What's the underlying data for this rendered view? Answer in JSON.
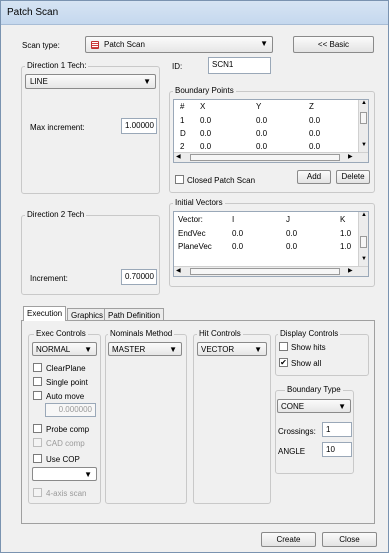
{
  "window": {
    "title": "Patch Scan"
  },
  "scan_type": {
    "label": "Scan type:",
    "value": "Patch Scan",
    "basic_button": "<< Basic"
  },
  "id": {
    "label": "ID:",
    "value": "SCN1"
  },
  "dir1": {
    "label": "Direction 1 Tech:",
    "value": "LINE",
    "max_inc_label": "Max increment:",
    "max_inc_value": "1.00000"
  },
  "dir2": {
    "label": "Direction 2 Tech",
    "inc_label": "Increment:",
    "inc_value": "0.70000"
  },
  "boundary_points": {
    "label": "Boundary Points",
    "columns": [
      "#",
      "X",
      "Y",
      "Z"
    ],
    "rows": [
      [
        "1",
        "0.0",
        "0.0",
        "0.0"
      ],
      [
        "D",
        "0.0",
        "0.0",
        "0.0"
      ],
      [
        "2",
        "0.0",
        "0.0",
        "0.0"
      ]
    ],
    "closed_label": "Closed Patch Scan",
    "add": "Add",
    "delete": "Delete"
  },
  "initial_vectors": {
    "label": "Initial Vectors",
    "columns": [
      "Vector:",
      "I",
      "J",
      "K"
    ],
    "rows": [
      [
        "EndVec",
        "0.0",
        "0.0",
        "1.0"
      ],
      [
        "PlaneVec",
        "0.0",
        "0.0",
        "1.0"
      ]
    ]
  },
  "tabs": [
    "Execution",
    "Graphics",
    "Path Definition"
  ],
  "exec_controls": {
    "label": "Exec Controls",
    "mode": "NORMAL",
    "clearplane": "ClearPlane",
    "single_point": "Single point",
    "auto_move": "Auto move",
    "auto_move_value": "0.000000",
    "probe_comp": "Probe comp",
    "cad_comp": "CAD comp",
    "use_cop": "Use COP",
    "four_axis": "4-axis scan"
  },
  "nominals": {
    "label": "Nominals Method",
    "value": "MASTER"
  },
  "hit_controls": {
    "label": "Hit Controls",
    "value": "VECTOR"
  },
  "display_controls": {
    "label": "Display Controls",
    "show_hits": "Show hits",
    "show_all": "Show all",
    "show_all_checked": true
  },
  "boundary_type": {
    "label": "Boundary Type",
    "value": "CONE",
    "crossings_label": "Crossings:",
    "crossings_value": "1",
    "angle_label": "ANGLE",
    "angle_value": "10"
  },
  "footer": {
    "create": "Create",
    "close": "Close"
  }
}
